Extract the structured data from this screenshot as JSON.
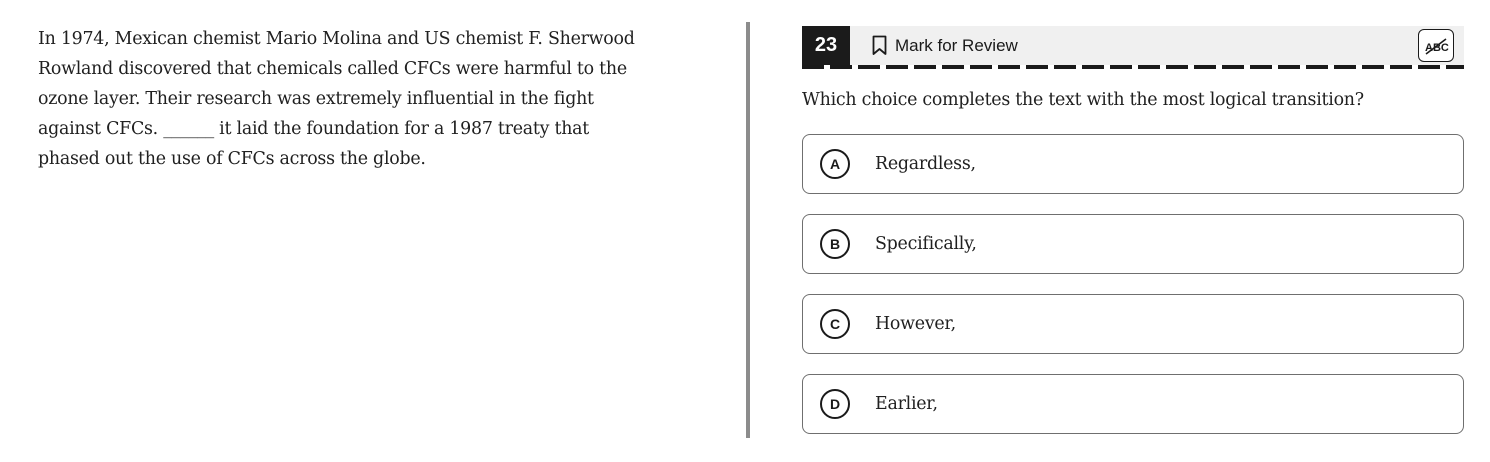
{
  "passage": {
    "lines": [
      "In 1974, Mexican chemist Mario Molina and US chemist F. Sherwood",
      "Rowland discovered that chemicals called CFCs were harmful to the",
      "ozone layer. Their research was extremely influential in the fight",
      "against CFCs. ______ it laid the foundation for a 1987 treaty that",
      "phased out the use of CFCs across the globe."
    ]
  },
  "header": {
    "question_number": "23",
    "mark_for_review": "Mark for Review",
    "bookmark_icon": "bookmark-icon",
    "abc_icon": "abc-strikethrough-icon"
  },
  "question": {
    "prompt": "Which choice completes the text with the most logical transition?"
  },
  "options": [
    {
      "letter": "A",
      "text": "Regardless,"
    },
    {
      "letter": "B",
      "text": "Specifically,"
    },
    {
      "letter": "C",
      "text": "However,"
    },
    {
      "letter": "D",
      "text": "Earlier,"
    }
  ],
  "colors": {
    "header_bg": "#f0f0f0",
    "number_bg": "#1b1b1b",
    "divider": "#8c8c8c",
    "option_border": "#6f6f6f"
  }
}
